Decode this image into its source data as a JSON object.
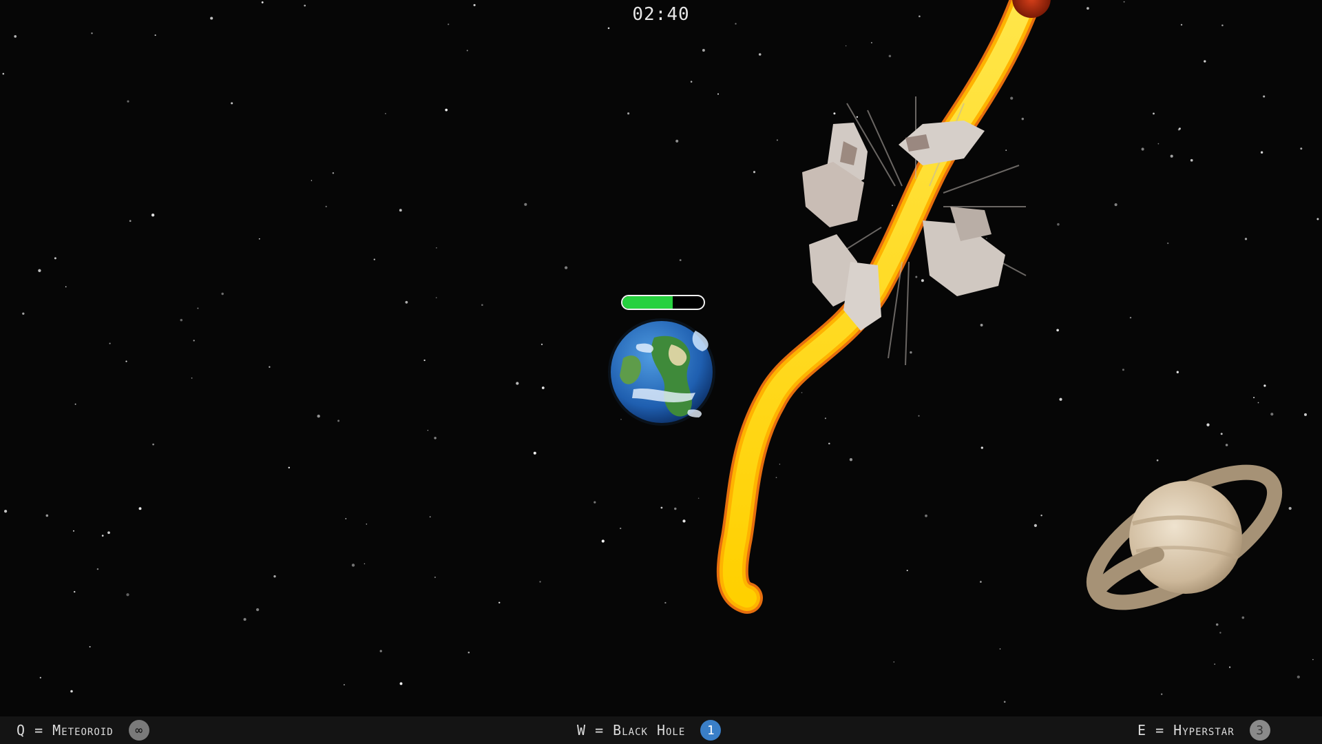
{
  "hud": {
    "timer": "02:40",
    "planet_health": 0.62
  },
  "abilities": [
    {
      "key": "Q",
      "label": "Q = Meteoroid",
      "count": "∞",
      "badge_color": "#7a7a7a",
      "badge_text_color": "#101010"
    },
    {
      "key": "W",
      "label": "W = Black Hole",
      "count": "1",
      "badge_color": "#3a7fc8",
      "badge_text_color": "#ffffff"
    },
    {
      "key": "E",
      "label": "E = Hyperstar",
      "count": "3",
      "badge_color": "#8a8a8a",
      "badge_text_color": "#3a3a3a"
    }
  ],
  "colors": {
    "health": "#27d13f",
    "fire": "#ffd21a",
    "fire_edge": "#ff7a10",
    "space": "#060606"
  },
  "icons": {
    "home_planet": "earth-planet-icon",
    "ringed_planet": "ringed-planet-icon",
    "meteoroid": "meteoroid-fire-trail",
    "debris": "asteroid-debris"
  }
}
